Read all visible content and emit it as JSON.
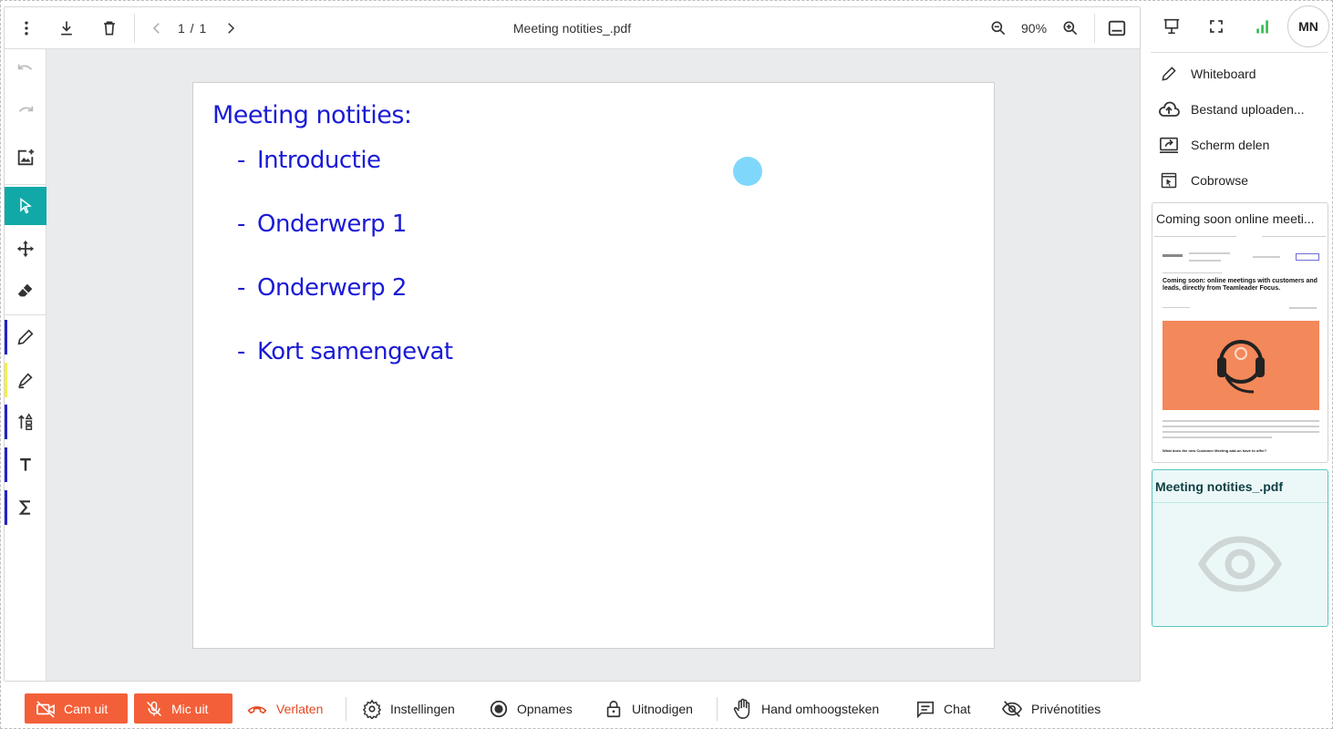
{
  "viewer": {
    "page_indicator": "1 / 1",
    "title": "Meeting notities_.pdf",
    "zoom": "90%"
  },
  "document": {
    "heading": "Meeting notities:",
    "items": [
      "Introductie",
      "Onderwerp 1",
      "Onderwerp 2",
      "Kort samengevat"
    ],
    "bullet": "-"
  },
  "toolbar_left": {
    "stripe_colors": [
      "#2323c8",
      "#f1f14a",
      "#2323c8",
      "#2323c8",
      "#2323c8"
    ],
    "active_color": "#11a9a8"
  },
  "right_panel": {
    "avatar_initials": "MN",
    "menu": [
      {
        "label": "Whiteboard",
        "icon": "pencil-icon"
      },
      {
        "label": "Bestand uploaden...",
        "icon": "cloud-upload-icon"
      },
      {
        "label": "Scherm delen",
        "icon": "screen-share-icon"
      },
      {
        "label": "Cobrowse",
        "icon": "cobrowse-icon"
      }
    ],
    "cards": [
      {
        "title": "Coming soon online meeti...",
        "thumb_heading": "Coming soon: online meetings with customers and leads, directly from Teamleader Focus.",
        "thumb_question": "What does the new Customer Meeting add-on have to offer?"
      },
      {
        "title": "Meeting notities_.pdf"
      }
    ]
  },
  "bottom_bar": {
    "cam": "Cam uit",
    "mic": "Mic uit",
    "leave": "Verlaten",
    "settings": "Instellingen",
    "record": "Opnames",
    "invite": "Uitnodigen",
    "raise_hand": "Hand omhoogsteken",
    "chat": "Chat",
    "private_notes": "Privénotities"
  },
  "colors": {
    "accent": "#11a9a8",
    "danger": "#f35f38",
    "doc_text": "#1b1bd6",
    "signal": "#2db84d"
  }
}
